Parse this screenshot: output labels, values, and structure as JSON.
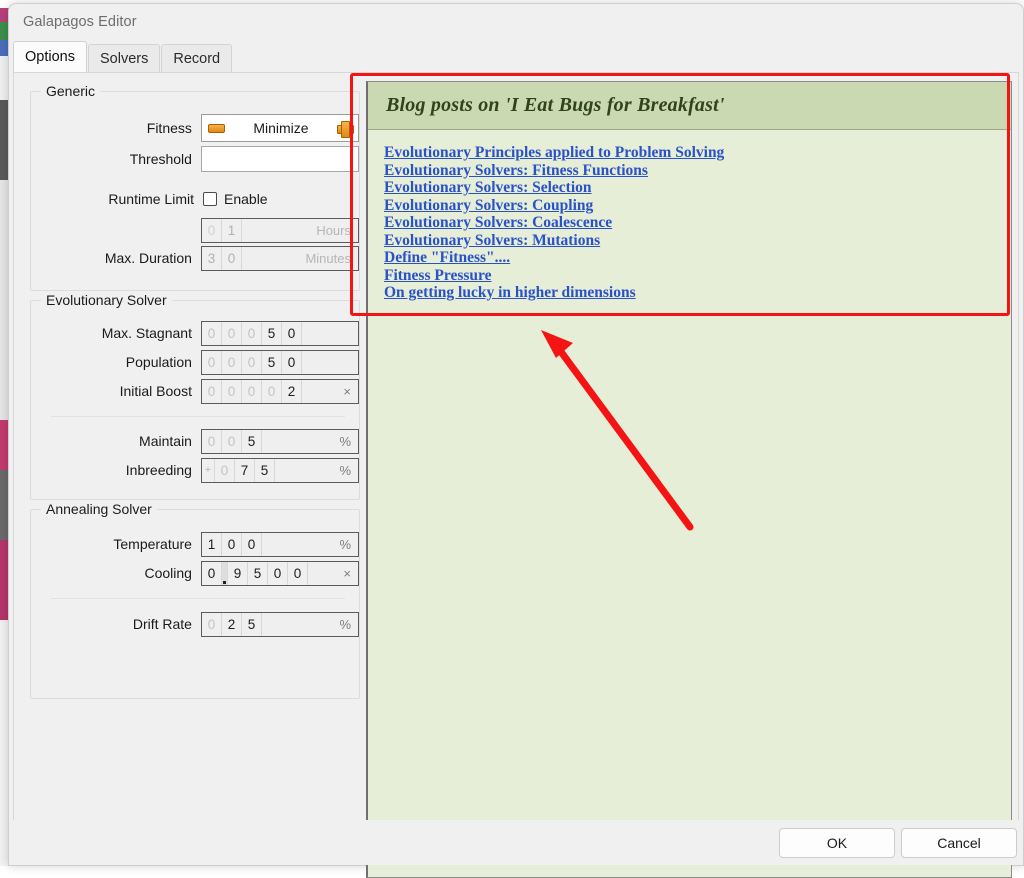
{
  "window": {
    "title": "Galapagos Editor"
  },
  "tabs": [
    {
      "label": "Options",
      "active": true
    },
    {
      "label": "Solvers",
      "active": false
    },
    {
      "label": "Record",
      "active": false
    }
  ],
  "groups": {
    "generic": {
      "title": "Generic",
      "fitness": {
        "label": "Fitness",
        "value": "Minimize",
        "minus_icon": "minus-icon",
        "plus_icon": "plus-icon"
      },
      "threshold": {
        "label": "Threshold",
        "value": "",
        "placeholder": ""
      },
      "runtime_limit": {
        "label": "Runtime Limit",
        "checkbox_label": "Enable",
        "checked": false
      },
      "max_duration": {
        "label": "Max. Duration",
        "hours": {
          "digits": [
            "0",
            "1"
          ],
          "dim": [
            true,
            false
          ],
          "unit": "Hours",
          "disabled": true
        },
        "minutes": {
          "digits": [
            "3",
            "0"
          ],
          "dim": [
            false,
            false
          ],
          "unit": "Minutes",
          "disabled": true
        }
      }
    },
    "evolutionary": {
      "title": "Evolutionary Solver",
      "rows": [
        {
          "label": "Max. Stagnant",
          "digits": [
            "0",
            "0",
            "0",
            "5",
            "0"
          ],
          "dim": [
            true,
            true,
            true,
            false,
            false
          ],
          "unit": ""
        },
        {
          "label": "Population",
          "digits": [
            "0",
            "0",
            "0",
            "5",
            "0"
          ],
          "dim": [
            true,
            true,
            true,
            false,
            false
          ],
          "unit": ""
        },
        {
          "label": "Initial Boost",
          "digits": [
            "0",
            "0",
            "0",
            "0",
            "2"
          ],
          "dim": [
            true,
            true,
            true,
            true,
            false
          ],
          "unit": "×"
        },
        {
          "label": "Maintain",
          "digits": [
            "0",
            "0",
            "5"
          ],
          "dim": [
            true,
            true,
            false
          ],
          "unit": "%"
        },
        {
          "label": "Inbreeding",
          "sign": "+",
          "digits": [
            "0",
            "7",
            "5"
          ],
          "dim": [
            true,
            false,
            false
          ],
          "unit": "%"
        }
      ]
    },
    "annealing": {
      "title": "Annealing Solver",
      "rows": [
        {
          "label": "Temperature",
          "digits": [
            "1",
            "0",
            "0"
          ],
          "dim": [
            false,
            false,
            false
          ],
          "unit": "%"
        },
        {
          "label": "Cooling",
          "digits": [
            "0",
            ".",
            "9",
            "5",
            "0",
            "0"
          ],
          "dim": [
            false,
            false,
            false,
            false,
            false,
            false
          ],
          "unit": "×"
        },
        {
          "label": "Drift Rate",
          "digits": [
            "0",
            "2",
            "5"
          ],
          "dim": [
            true,
            false,
            false
          ],
          "unit": "%"
        }
      ]
    }
  },
  "blog": {
    "header": "Blog posts on 'I Eat Bugs for Breakfast'",
    "links": [
      "Evolutionary Principles applied to Problem Solving",
      "Evolutionary Solvers: Fitness Functions",
      "Evolutionary Solvers: Selection",
      "Evolutionary Solvers: Coupling",
      "Evolutionary Solvers: Coalescence",
      "Evolutionary Solvers: Mutations",
      "Define \"Fitness\"....",
      "Fitness Pressure",
      "On getting lucky in higher dimensions"
    ]
  },
  "footer": {
    "ok_label": "OK",
    "cancel_label": "Cancel"
  },
  "annotation": {
    "highlight_color": "#f41414",
    "arrow_color": "#f41414"
  }
}
